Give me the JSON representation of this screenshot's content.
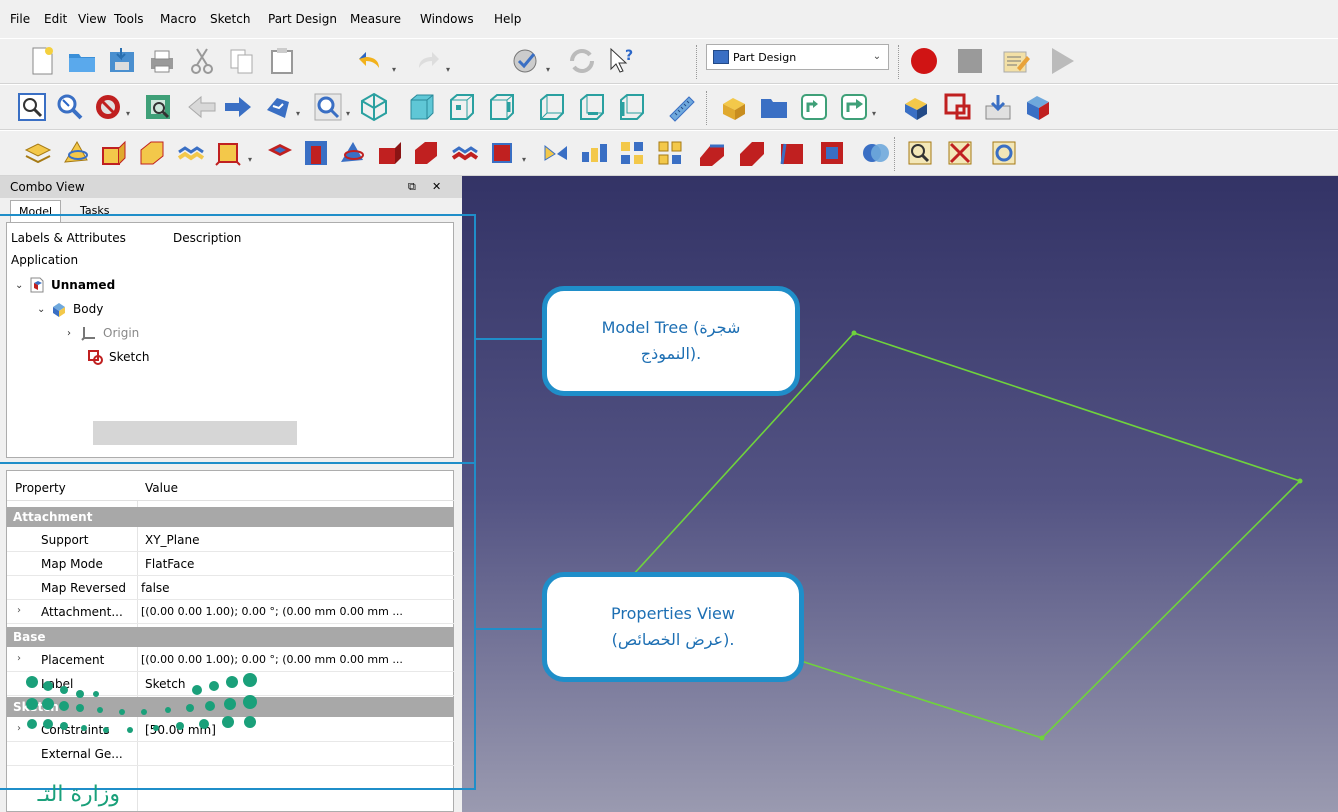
{
  "menu": [
    "File",
    "Edit",
    "View",
    "Tools",
    "Macro",
    "Sketch",
    "Part Design",
    "Measure",
    "Windows",
    "Help"
  ],
  "workbench_selector": {
    "value": "Part Design"
  },
  "combo_view": {
    "title": "Combo View",
    "tabs": [
      "Model",
      "Tasks"
    ],
    "tree": {
      "col1": "Labels & Attributes",
      "col2": "Description",
      "application_label": "Application",
      "items": [
        {
          "label": "Unnamed",
          "icon": "document-icon"
        },
        {
          "label": "Body",
          "icon": "body-icon"
        },
        {
          "label": "Origin",
          "icon": "origin-icon"
        },
        {
          "label": "Sketch",
          "icon": "sketch-icon"
        }
      ]
    },
    "properties": {
      "col_property": "Property",
      "col_value": "Value",
      "groups": {
        "attachment": "Attachment",
        "base": "Base",
        "sketch": "Sketch"
      },
      "rows": {
        "support": {
          "key": "Support",
          "value": "XY_Plane"
        },
        "map_mode": {
          "key": "Map Mode",
          "value": "FlatFace"
        },
        "map_reversed": {
          "key": "Map Reversed",
          "value": "false"
        },
        "attachment_offset": {
          "key": "Attachment...",
          "value": "[(0.00 0.00 1.00); 0.00 °; (0.00 mm  0.00 mm ..."
        },
        "placement": {
          "key": "Placement",
          "value": "[(0.00 0.00 1.00); 0.00 °; (0.00 mm  0.00 mm ..."
        },
        "label": {
          "key": "Label",
          "value": "Sketch"
        },
        "constraints": {
          "key": "Constraints",
          "value": "[50.00 mm]"
        },
        "external_geo": {
          "key": "External Ge...",
          "value": ""
        }
      }
    }
  },
  "callouts": {
    "model_tree": {
      "line1": "Model Tree (شجرة",
      "line2": "النموذج)."
    },
    "properties_view": {
      "line1": "Properties View",
      "line2": "(عرض الخصائص)."
    }
  },
  "logo": {
    "text": "وزارة التـ"
  },
  "colors": {
    "callout_border": "#1f8ec9",
    "sketch_line": "#6fd33c",
    "viewport_top": "#333366",
    "viewport_bottom": "#9a9ab0"
  }
}
